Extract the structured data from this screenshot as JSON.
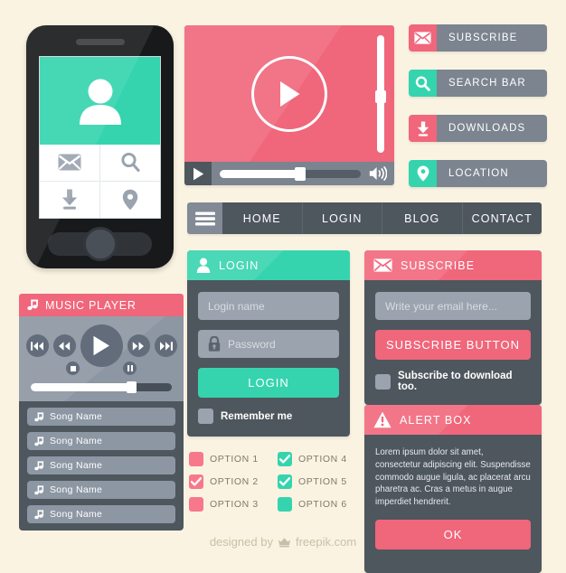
{
  "theme": {
    "background": "#fbf3e2",
    "pink": "#f0667b",
    "teal": "#35d4ae",
    "slate_dark": "#4e565e",
    "slate_mid": "#7b848f",
    "slate_light": "#9aa3ae"
  },
  "phone": {
    "name": "mobile-mockup",
    "avatar_icon": "user-icon",
    "grid_icons": [
      "envelope-icon",
      "search-icon",
      "download-icon",
      "location-pin-icon"
    ]
  },
  "music_player": {
    "title": "MUSIC PLAYER",
    "title_icon": "music-note-icon",
    "controls": [
      {
        "icon": "skip-previous-icon",
        "name": "skip-previous-button"
      },
      {
        "icon": "rewind-icon",
        "name": "rewind-button"
      },
      {
        "icon": "play-icon",
        "name": "play-button"
      },
      {
        "icon": "fast-forward-icon",
        "name": "fast-forward-button"
      },
      {
        "icon": "skip-next-icon",
        "name": "skip-next-button"
      }
    ],
    "sub_controls": [
      {
        "icon": "stop-icon",
        "name": "stop-button"
      },
      {
        "icon": "pause-icon",
        "name": "pause-button"
      }
    ],
    "seek_percent": 73,
    "songs": [
      {
        "label": "Song Name",
        "icon": "music-note-icon"
      },
      {
        "label": "Song Name",
        "icon": "music-note-icon"
      },
      {
        "label": "Song Name",
        "icon": "music-note-icon"
      },
      {
        "label": "Song Name",
        "icon": "music-note-icon"
      },
      {
        "label": "Song Name",
        "icon": "music-note-icon"
      }
    ]
  },
  "video_player": {
    "play_icon": "play-circle-icon",
    "bar_play_icon": "play-icon",
    "volume_icon": "volume-up-icon",
    "seek_percent": 58,
    "volume_percent": 50
  },
  "side_buttons": [
    {
      "label": "SUBSCRIBE",
      "icon": "envelope-icon",
      "accent": "pink"
    },
    {
      "label": "SEARCH BAR",
      "icon": "search-icon",
      "accent": "teal"
    },
    {
      "label": "DOWNLOADS",
      "icon": "download-icon",
      "accent": "pink"
    },
    {
      "label": "LOCATION",
      "icon": "location-pin-icon",
      "accent": "teal"
    }
  ],
  "nav": {
    "menu_icon": "hamburger-menu-icon",
    "items": [
      "HOME",
      "LOGIN",
      "BLOG",
      "CONTACT"
    ]
  },
  "login_card": {
    "title": "LOGIN",
    "title_icon": "user-icon",
    "username_placeholder": "Login name",
    "password_placeholder": "Password",
    "password_icon": "lock-icon",
    "submit_label": "LOGIN",
    "remember_label": "Remember me",
    "remember_checked": false
  },
  "subscribe_card": {
    "title": "SUBSCRIBE",
    "title_icon": "envelope-icon",
    "email_placeholder": "Write your email here...",
    "submit_label": "SUBSCRIBE BUTTON",
    "checkbox_label": "Subscribe to download too.",
    "checkbox_checked": false
  },
  "alert_card": {
    "title": "ALERT BOX",
    "title_icon": "warning-icon",
    "body": "Lorem ipsum dolor sit amet, consectetur adipiscing elit. Suspendisse commodo augue ligula, ac placerat arcu pharetra ac. Cras a metus in augue imperdiet hendrerit.",
    "ok_label": "OK"
  },
  "options": [
    {
      "label": "OPTION 1",
      "accent": "pink",
      "checked": false
    },
    {
      "label": "OPTION 4",
      "accent": "teal",
      "checked": true
    },
    {
      "label": "OPTION 2",
      "accent": "pink",
      "checked": true
    },
    {
      "label": "OPTION 5",
      "accent": "teal",
      "checked": true
    },
    {
      "label": "OPTION 3",
      "accent": "pink",
      "checked": false
    },
    {
      "label": "OPTION 6",
      "accent": "teal",
      "checked": false
    }
  ],
  "footer": {
    "prefix": "designed by",
    "brand": "freepik.com",
    "mark_icon": "freepik-crown-icon"
  }
}
